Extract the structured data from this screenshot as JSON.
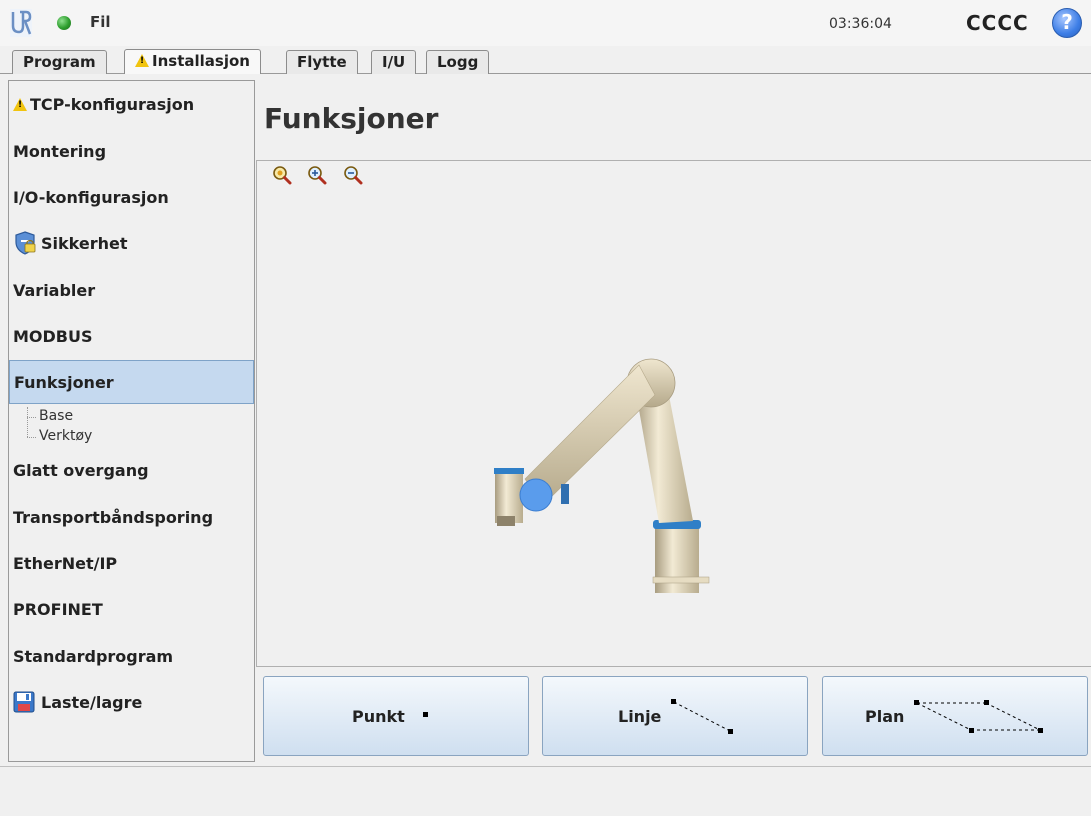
{
  "header": {
    "file_menu": "Fil",
    "clock": "03:36:04",
    "robot_name": "CCCC",
    "help_glyph": "?",
    "status_color": "#2e9e2e"
  },
  "tabs": [
    {
      "label": "Program",
      "active": false
    },
    {
      "label": "Installasjon",
      "active": true,
      "warning": true
    },
    {
      "label": "Flytte",
      "active": false
    },
    {
      "label": "I/U",
      "active": false
    },
    {
      "label": "Logg",
      "active": false
    }
  ],
  "sidebar": {
    "items": [
      {
        "label": "TCP-konfigurasjon",
        "icon": "warning-icon"
      },
      {
        "label": "Montering"
      },
      {
        "label": "I/O-konfigurasjon"
      },
      {
        "label": "Sikkerhet",
        "icon": "shield-lock-icon"
      },
      {
        "label": "Variabler"
      },
      {
        "label": "MODBUS"
      },
      {
        "label": "Funksjoner",
        "selected": true
      },
      {
        "label": "Glatt overgang"
      },
      {
        "label": "Transportbåndsporing"
      },
      {
        "label": "EtherNet/IP"
      },
      {
        "label": "PROFINET"
      },
      {
        "label": "Standardprogram"
      },
      {
        "label": "Laste/lagre",
        "icon": "floppy-disk-icon"
      }
    ],
    "sub_items": [
      "Base",
      "Verktøy"
    ]
  },
  "main": {
    "title": "Funksjoner",
    "zoom_icons": [
      "zoom-fit-icon",
      "zoom-in-icon",
      "zoom-out-icon"
    ]
  },
  "buttons": {
    "point": "Punkt",
    "line": "Linje",
    "plane": "Plan"
  },
  "colors": {
    "selected_bg": "#c5d9ef",
    "button_gradient_top": "#f4f8fc",
    "button_gradient_bottom": "#cfdff0",
    "joint_blue": "#2f7fc7"
  }
}
